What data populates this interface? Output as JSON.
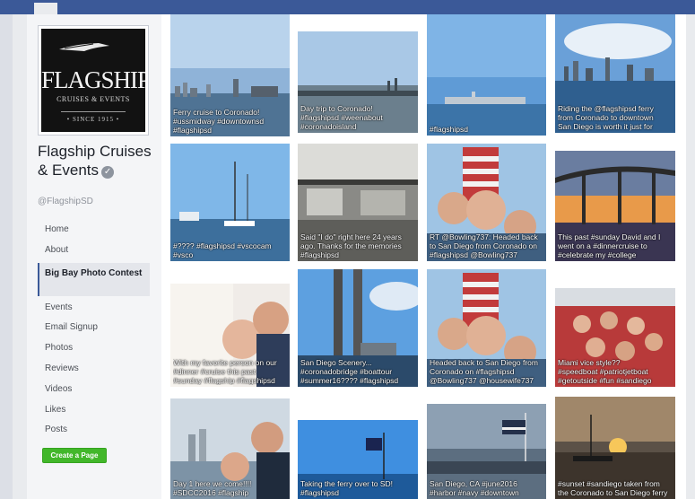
{
  "logo": {
    "brand": "FLAGSHIP",
    "sub": "CRUISES & EVENTS",
    "since": "• SINCE 1915 •"
  },
  "page": {
    "name": "Flagship Cruises & Events",
    "handle": "@FlagshipSD",
    "verified_icon": "verified-check-icon"
  },
  "nav": {
    "items": [
      {
        "label": "Home",
        "active": false
      },
      {
        "label": "About",
        "active": false
      },
      {
        "label": "Big Bay Photo Contest",
        "active": true
      },
      {
        "label": "Events",
        "active": false
      },
      {
        "label": "Email Signup",
        "active": false
      },
      {
        "label": "Photos",
        "active": false
      },
      {
        "label": "Reviews",
        "active": false
      },
      {
        "label": "Videos",
        "active": false
      },
      {
        "label": "Likes",
        "active": false
      },
      {
        "label": "Posts",
        "active": false
      }
    ]
  },
  "create_page_label": "Create a Page",
  "colors": {
    "header": "#3b5998",
    "create_button": "#42b72a"
  },
  "photos": [
    {
      "caption": "Ferry cruise to Coronado!\n#ussmidway #downtownsd\n#flagshipsd"
    },
    {
      "caption": "Day trip to Coronado!\n#flagshipsd #weenabout\n#coronadoisland"
    },
    {
      "caption": "#flagshipsd"
    },
    {
      "caption": "Riding the @flagshipsd ferry\nfrom Coronado to downtown\nSan Diego is worth it just for"
    },
    {
      "caption": "#???? #flagshipsd #vscocam\n#vsco"
    },
    {
      "caption": "Said \"I do\" right here 24 years\nago. Thanks for the memories\n#flagshipsd"
    },
    {
      "caption": "RT @Bowling737: Headed back\nto San Diego from Coronado on\n#flagshipsd @Bowling737"
    },
    {
      "caption": "This past #sunday David and I\nwent on a #dinnercruise to\n#celebrate my #college"
    },
    {
      "caption": "With my favorite person on our\n#dinner #cruise this past\n#sunday #flagship #flagshipsd"
    },
    {
      "caption": "San Diego Scenery...\n#coronadobridge #boattour\n#summer16???? #flagshipsd"
    },
    {
      "caption": "Headed back to San Diego from\nCoronado on #flagshipsd\n@Bowling737 @housewife737"
    },
    {
      "caption": "Miami vice style??\n#speedboat #patriotjetboat\n#getoutside #fun #sandiego"
    },
    {
      "caption": "Day 1 here we come!!!!\n#SDCC2016 #flagship"
    },
    {
      "caption": "Taking the ferry over to SD!\n#flagshipsd"
    },
    {
      "caption": "San Diego, CA #june2016\n#harbor #navy #downtown"
    },
    {
      "caption": "#sunset #sandiego taken from\nthe Coronado to San Diego ferry"
    }
  ]
}
